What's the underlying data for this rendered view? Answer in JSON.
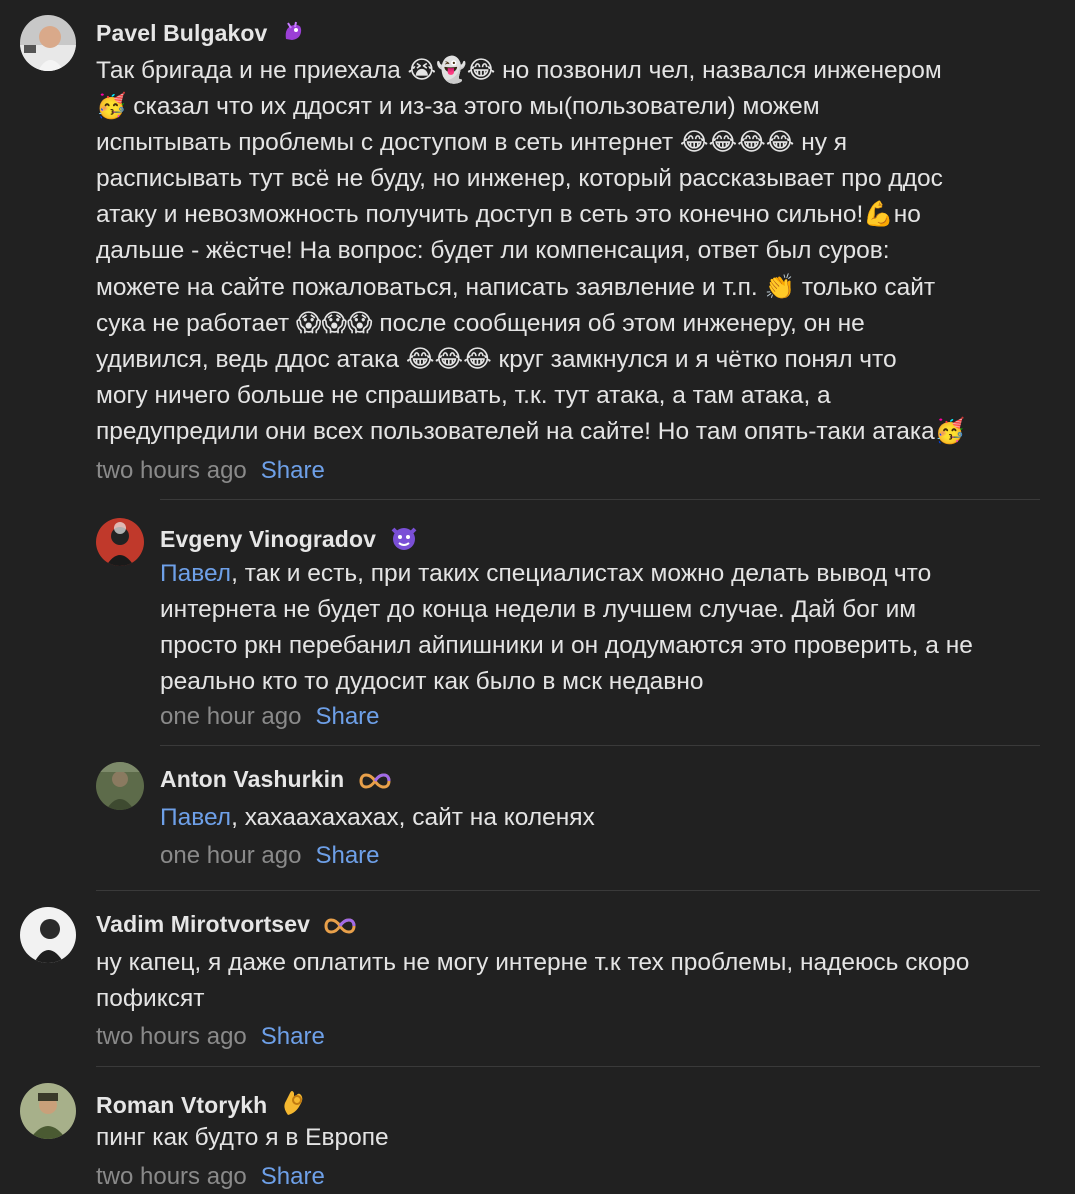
{
  "comments": [
    {
      "author": "Pavel Bulgakov",
      "text": "Так бригада и не приехала 😭👻😂 но позвонил чел, назвался инженером\n🥳 сказал что их ддосят и из-за этого мы(пользователи) можем\nиспытывать проблемы с доступом в сеть интернет 😂😂😂😂 ну я\nрасписывать тут всё не буду, но инженер, который рассказывает про ддос\nатаку и невозможность получить доступ в сеть это конечно сильно!💪но\nдальше - жёстче! На вопрос: будет ли компенсация, ответ был суров:\nможете на сайте пожаловаться, написать заявление и т.п. 👏 только сайт\nсука не работает 😱😱😱 после сообщения об этом инженеру, он не\nудивился, ведь ддос атака 😂😂😂 круг замкнулся и я чётко понял что\nмогу ничего больше не спрашивать, т.к. тут атака, а там атака, а\nпредупредили они всех пользователей на сайте! Но там опять-таки атака🥳",
      "time": "two hours ago",
      "share": "Share"
    },
    {
      "author": "Evgeny Vinogradov",
      "mention": "Павел",
      "text": ", так и есть, при таких специалистах можно делать вывод что\nинтернета не будет до конца недели в лучшем случае. Дай бог им\nпросто ркн перебанил айпишники и он додумаются это проверить, а не\nреально кто то дудосит как было в мск недавно",
      "time": "one hour ago",
      "share": "Share"
    },
    {
      "author": "Anton Vashurkin",
      "mention": "Павел",
      "text": ", хахаахахахах, сайт на коленях",
      "time": "one hour ago",
      "share": "Share"
    },
    {
      "author": "Vadim Mirotvortsev",
      "text": "ну капец, я даже оплатить не могу интерне т.к тех проблемы, надеюсь скоро\nпофиксят",
      "time": "two hours ago",
      "share": "Share"
    },
    {
      "author": "Roman Vtorykh",
      "text": "пинг как будто я в Европе",
      "time": "two hours ago",
      "share": "Share"
    }
  ],
  "badges": [
    "purple-dragon-badge",
    "devil-face-badge",
    "infinity-badge",
    "infinity-badge",
    "ok-hand-badge"
  ],
  "colors": {
    "background": "#212121",
    "link": "#6ea0e8",
    "meta": "#8a8a8a",
    "divider": "#3a3a3a"
  }
}
